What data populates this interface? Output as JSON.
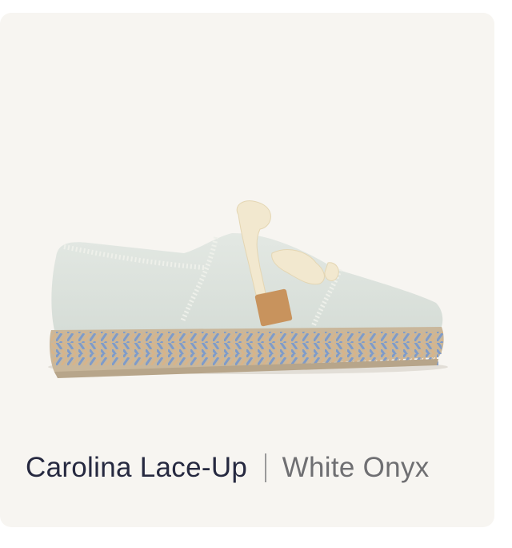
{
  "product": {
    "name": "Carolina Lace-Up",
    "color": "White Onyx"
  },
  "colors": {
    "card_background": "#f7f5f1",
    "name_text": "#262940",
    "color_text": "#6f6f72",
    "divider": "#9a9a9a"
  },
  "image": {
    "subject": "shoe-product-photo"
  }
}
